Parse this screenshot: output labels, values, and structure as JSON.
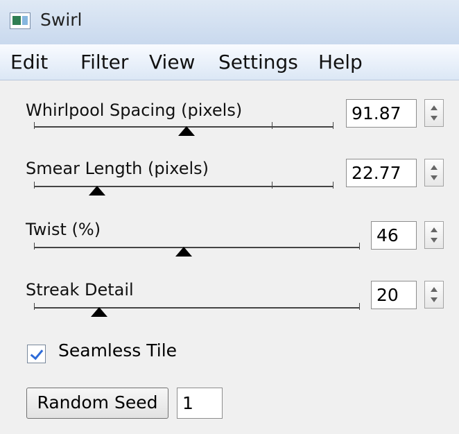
{
  "window": {
    "title": "Swirl",
    "icon": "image-icon"
  },
  "menu": {
    "items": [
      "Edit",
      "Filter",
      "View",
      "Settings",
      "Help"
    ]
  },
  "controls": {
    "whirlpool": {
      "label": "Whirlpool Spacing (pixels)",
      "value": "91.87",
      "slider_fraction": 0.51
    },
    "smear": {
      "label": "Smear Length (pixels)",
      "value": "22.77",
      "slider_fraction": 0.21
    },
    "twist": {
      "label": "Twist (%)",
      "value": "46",
      "slider_fraction": 0.46
    },
    "streak": {
      "label": "Streak Detail",
      "value": "20",
      "slider_fraction": 0.2
    }
  },
  "options": {
    "seamless_label": "Seamless Tile",
    "seamless_checked": true
  },
  "seed": {
    "button_label": "Random Seed",
    "value": "1"
  },
  "colors": {
    "title_bar": "#c9d9ee",
    "menu_bar": "#dbe7f5",
    "checkbox_mark": "#2e6bd8"
  }
}
